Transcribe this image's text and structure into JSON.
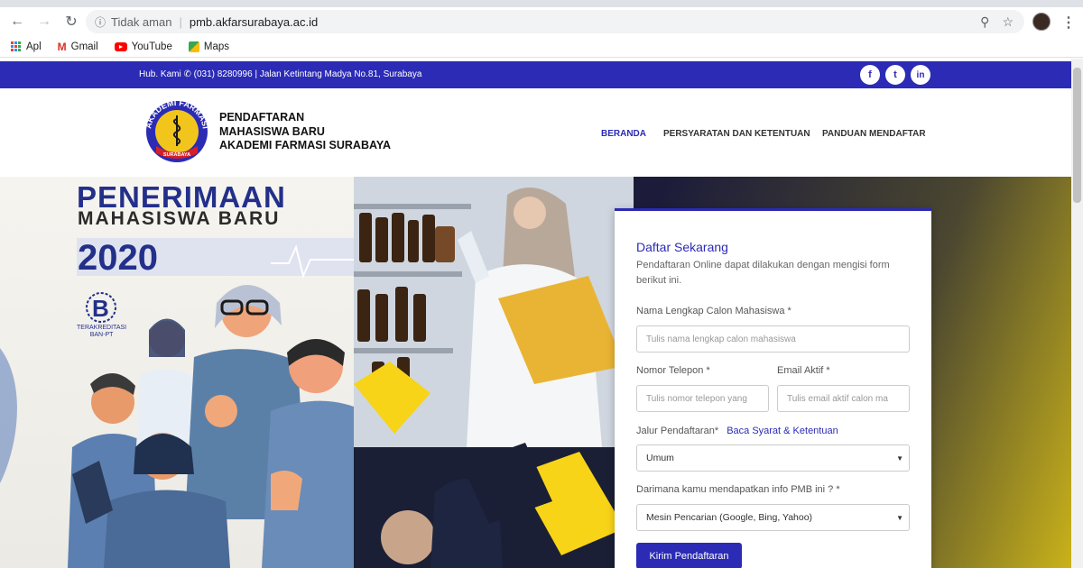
{
  "browser": {
    "security_label": "Tidak aman",
    "url": "pmb.akfarsurabaya.ac.id",
    "bookmarks": [
      {
        "label": "Apl",
        "icon": "apps-grid-icon"
      },
      {
        "label": "Gmail",
        "icon": "gmail-icon"
      },
      {
        "label": "YouTube",
        "icon": "youtube-icon"
      },
      {
        "label": "Maps",
        "icon": "maps-icon"
      }
    ]
  },
  "topbar": {
    "contact": "Hub. Kami  ✆ (031) 8280996 | Jalan Ketintang Madya No.81, Surabaya",
    "social": [
      "f",
      "t",
      "in"
    ]
  },
  "brand": {
    "line1": "PENDAFTARAN",
    "line2": "MAHASISWA BARU",
    "line3": "AKADEMI FARMASI SURABAYA",
    "logo_ring_text": "AKADEMI FARMASI",
    "logo_bottom_text": "SURABAYA"
  },
  "nav": {
    "items": [
      "BERANDA",
      "PERSYARATAN DAN KETENTUAN",
      "PANDUAN MENDAFTAR"
    ],
    "active_color": "#2b2bb5"
  },
  "poster": {
    "title1": "PENERIMAAN",
    "title2": "MAHASISWA BARU",
    "year": "2020",
    "accred_grade": "B",
    "accred_text1": "TERAKREDITASI",
    "accred_text2": "BAN-PT"
  },
  "form": {
    "title": "Daftar Sekarang",
    "description": "Pendaftaran Online dapat dilakukan dengan mengisi form berikut ini.",
    "name_label": "Nama Lengkap Calon Mahasiswa *",
    "name_placeholder": "Tulis nama lengkap calon mahasiswa",
    "phone_label": "Nomor Telepon *",
    "phone_placeholder": "Tulis nomor telepon yang",
    "email_label": "Email Aktif *",
    "email_placeholder": "Tulis email aktif calon ma",
    "path_label": "Jalur Pendaftaran*",
    "path_link": "Baca Syarat & Ketentuan",
    "path_value": "Umum",
    "source_label": "Darimana kamu mendapatkan info PMB ini ? *",
    "source_value": "Mesin Pencarian (Google, Bing, Yahoo)",
    "submit_label": "Kirim Pendaftaran"
  },
  "colors": {
    "primary": "#2b2bb5",
    "accent_yellow": "#f2c51d"
  }
}
